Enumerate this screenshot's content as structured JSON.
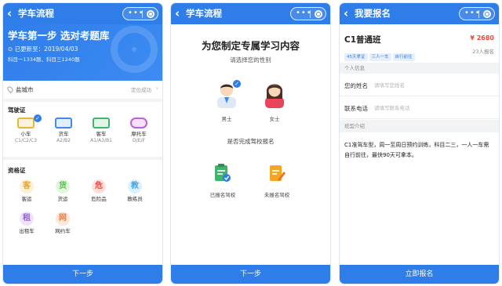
{
  "panel1": {
    "title": "学车流程",
    "hero": {
      "title": "学车第一步 选对考题库",
      "update": "已更新至：2019/04/03",
      "counts": "科目一1334题、科目三1240题"
    },
    "location": {
      "city": "盐城市",
      "status": "定位成功"
    },
    "license": {
      "heading": "驾驶证",
      "items": [
        {
          "name": "小车",
          "code": "C1/C2/C3",
          "color": "#e8b53a",
          "selected": true
        },
        {
          "name": "货车",
          "code": "A2/B2",
          "color": "#3f8be8"
        },
        {
          "name": "客车",
          "code": "A1/A3/B1",
          "color": "#3fb56a"
        },
        {
          "name": "摩托车",
          "code": "D/E/F",
          "color": "#c45be0"
        }
      ]
    },
    "qualification": {
      "heading": "资格证",
      "items": [
        {
          "name": "客运",
          "glyph": "客",
          "color": "#e8a32b",
          "bg": "#fdf1d9"
        },
        {
          "name": "货运",
          "glyph": "货",
          "color": "#5bc04a",
          "bg": "#e3f6dd"
        },
        {
          "name": "危险品",
          "glyph": "危",
          "color": "#f0463a",
          "bg": "#fde1df"
        },
        {
          "name": "教练员",
          "glyph": "教",
          "color": "#3fa9e8",
          "bg": "#ddf0fd"
        },
        {
          "name": "出租车",
          "glyph": "租",
          "color": "#9b5ee0",
          "bg": "#eee3fb"
        },
        {
          "name": "网约车",
          "glyph": "网",
          "color": "#f07a3a",
          "bg": "#fde7da"
        }
      ]
    },
    "button": "下一步"
  },
  "panel2": {
    "title": "学车流程",
    "heading": "为您制定专属学习内容",
    "gender_prompt": "请选择您的性别",
    "male": "男士",
    "female": "女士",
    "register_prompt": "是否完成驾校报名",
    "registered": "已报名驾校",
    "not_registered": "未报名驾校",
    "button": "下一步"
  },
  "panel3": {
    "title": "我要报名",
    "course": "C1普通班",
    "price": "¥ 2680",
    "tags": [
      "45天拿证",
      "三人一车",
      "自行前往"
    ],
    "enrolled": "23人报名",
    "personal_heading": "个人信息",
    "name_label": "您的姓名",
    "name_placeholder": "请填写您姓名",
    "phone_label": "联系电话",
    "phone_placeholder": "请填写联系电话",
    "class_heading": "班型介绍",
    "description": "C1准驾车型，周一至周日预约训练，科目二三，一人一车需自行前往，最快90天可拿本。",
    "button": "立即报名"
  },
  "colors": {
    "brand": "#2f7de9",
    "price": "#f0463a"
  }
}
